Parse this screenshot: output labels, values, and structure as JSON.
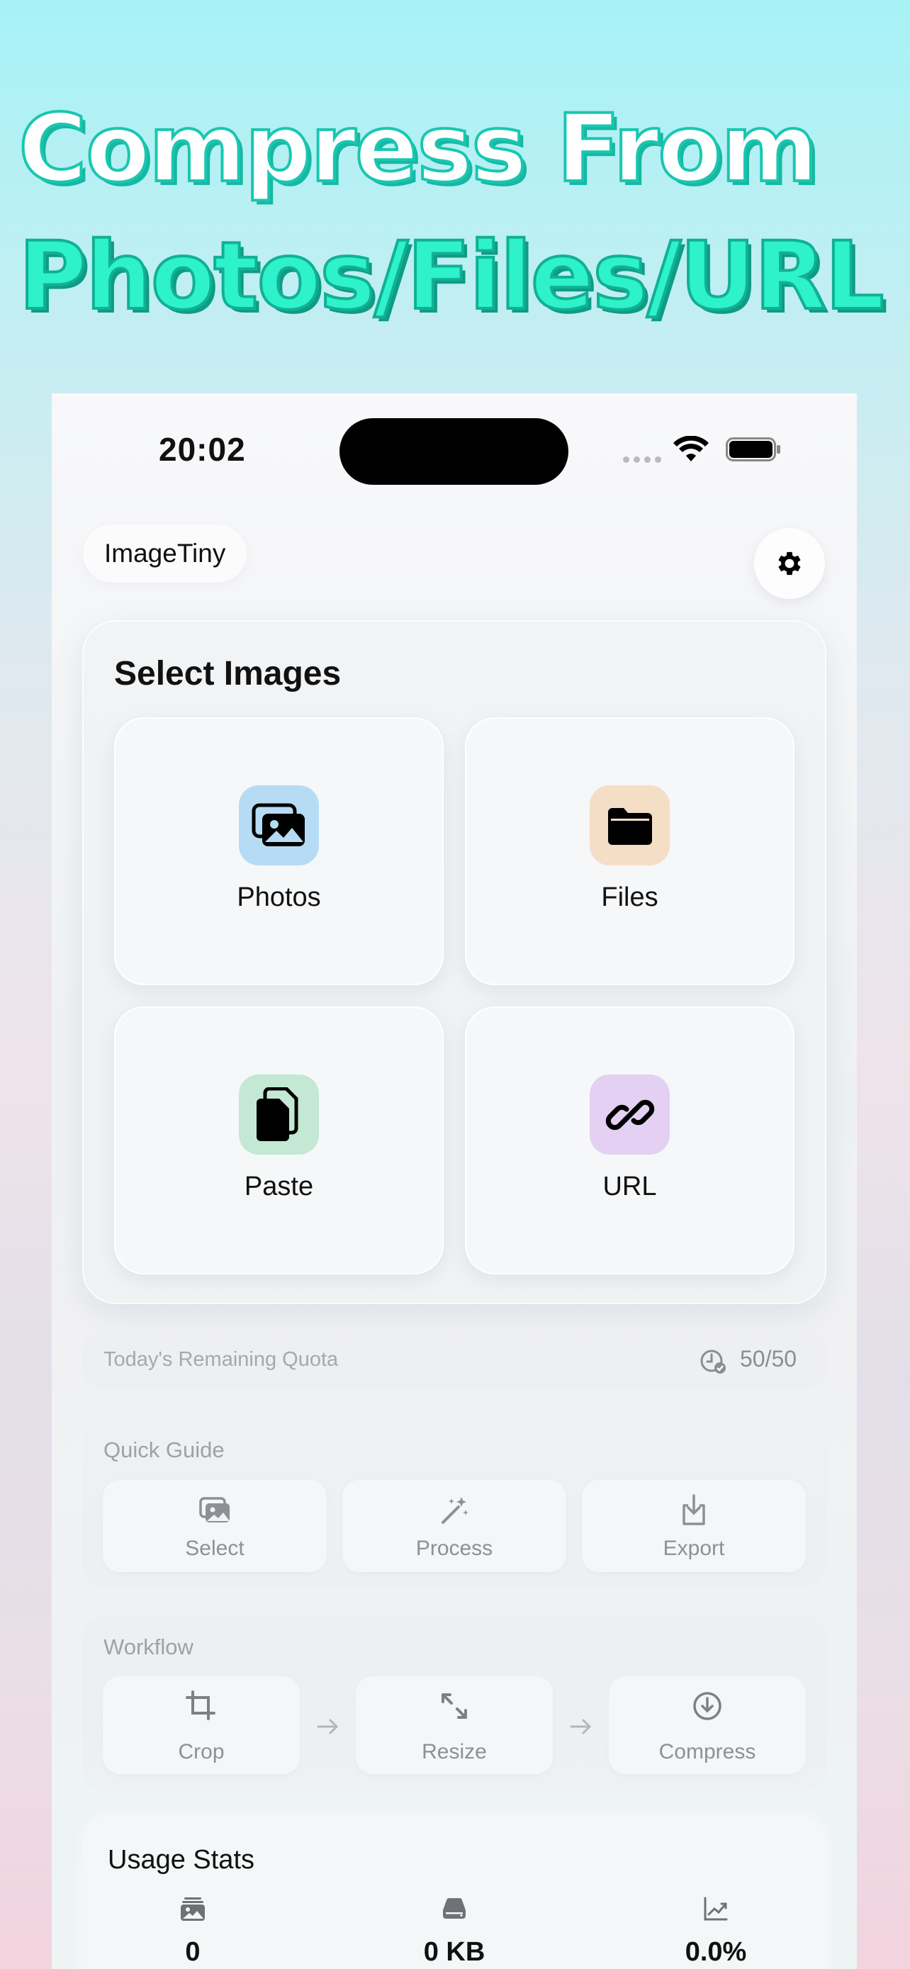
{
  "hero": {
    "line1": "Compress From",
    "line2": "Photos/Files/URL"
  },
  "status_bar": {
    "time": "20:02"
  },
  "app": {
    "title": "ImageTiny"
  },
  "select_images": {
    "title": "Select Images",
    "options": [
      {
        "label": "Photos",
        "icon": "photos-icon"
      },
      {
        "label": "Files",
        "icon": "folder-icon"
      },
      {
        "label": "Paste",
        "icon": "paste-icon"
      },
      {
        "label": "URL",
        "icon": "link-icon"
      }
    ]
  },
  "quota": {
    "label": "Today's Remaining Quota",
    "value": "50/50"
  },
  "quick_guide": {
    "title": "Quick Guide",
    "steps": [
      {
        "label": "Select",
        "icon": "photo-stack-icon"
      },
      {
        "label": "Process",
        "icon": "magic-wand-icon"
      },
      {
        "label": "Export",
        "icon": "export-icon"
      }
    ]
  },
  "workflow": {
    "title": "Workflow",
    "steps": [
      {
        "label": "Crop",
        "icon": "crop-icon"
      },
      {
        "label": "Resize",
        "icon": "resize-icon"
      },
      {
        "label": "Compress",
        "icon": "compress-icon"
      }
    ]
  },
  "usage_stats": {
    "title": "Usage Stats",
    "items": [
      {
        "value": "0",
        "icon": "images-icon"
      },
      {
        "value": "0 KB",
        "icon": "storage-icon"
      },
      {
        "value": "0.0%",
        "icon": "chart-icon"
      }
    ]
  }
}
